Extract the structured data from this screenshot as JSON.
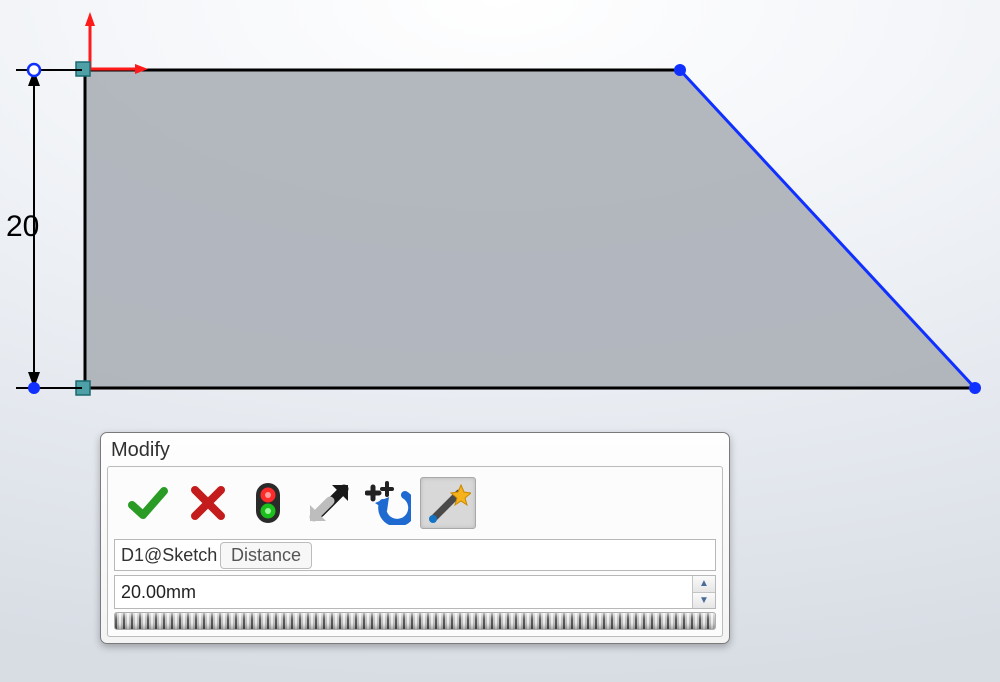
{
  "sketch": {
    "dimension_value": "20"
  },
  "modify_dialog": {
    "title": "Modify",
    "dimension_name": "D1@Sketch",
    "tooltip": "Distance",
    "value": "20.00mm",
    "icons": {
      "accept": "accept",
      "cancel": "cancel",
      "traffic": "traffic-light",
      "reverse": "reverse",
      "rebuild": "rebuild",
      "mark": "mark-for-drawing"
    }
  }
}
